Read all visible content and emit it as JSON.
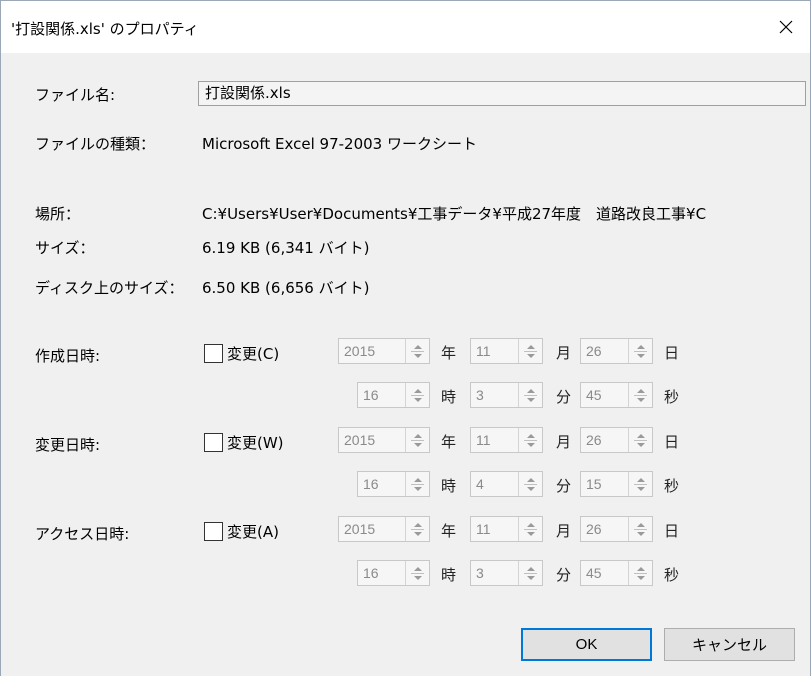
{
  "window": {
    "title": "'打設関係.xls' のプロパティ",
    "close_glyph": "✕"
  },
  "info": {
    "filename_label": "ファイル名:",
    "filename_value": "打設関係.xls",
    "type_label": "ファイルの種類：",
    "type_value": "Microsoft Excel 97-2003 ワークシート",
    "location_label": "場所：",
    "location_value": "C:¥Users¥User¥Documents¥工事データ¥平成27年度　道路改良工事¥C",
    "size_label": "サイズ：",
    "size_value": "6.19 KB (6,341 バイト)",
    "disk_size_label": "ディスク上のサイズ：",
    "disk_size_value": "6.50 KB (6,656 バイト)"
  },
  "units": {
    "year": "年",
    "month": "月",
    "day": "日",
    "hour": "時",
    "minute": "分",
    "second": "秒"
  },
  "dates": [
    {
      "label": "作成日時:",
      "checkbox_label": "変更(C)",
      "checked": false,
      "year": "2015",
      "month": "11",
      "day": "26",
      "hour": "16",
      "minute": "3",
      "second": "45"
    },
    {
      "label": "変更日時:",
      "checkbox_label": "変更(W)",
      "checked": false,
      "year": "2015",
      "month": "11",
      "day": "26",
      "hour": "16",
      "minute": "4",
      "second": "15"
    },
    {
      "label": "アクセス日時:",
      "checkbox_label": "変更(A)",
      "checked": false,
      "year": "2015",
      "month": "11",
      "day": "26",
      "hour": "16",
      "minute": "3",
      "second": "45"
    }
  ],
  "buttons": {
    "ok": "OK",
    "cancel": "キャンセル"
  },
  "colors": {
    "accent": "#0078d7",
    "dialog_bg": "#f0f0f0"
  }
}
